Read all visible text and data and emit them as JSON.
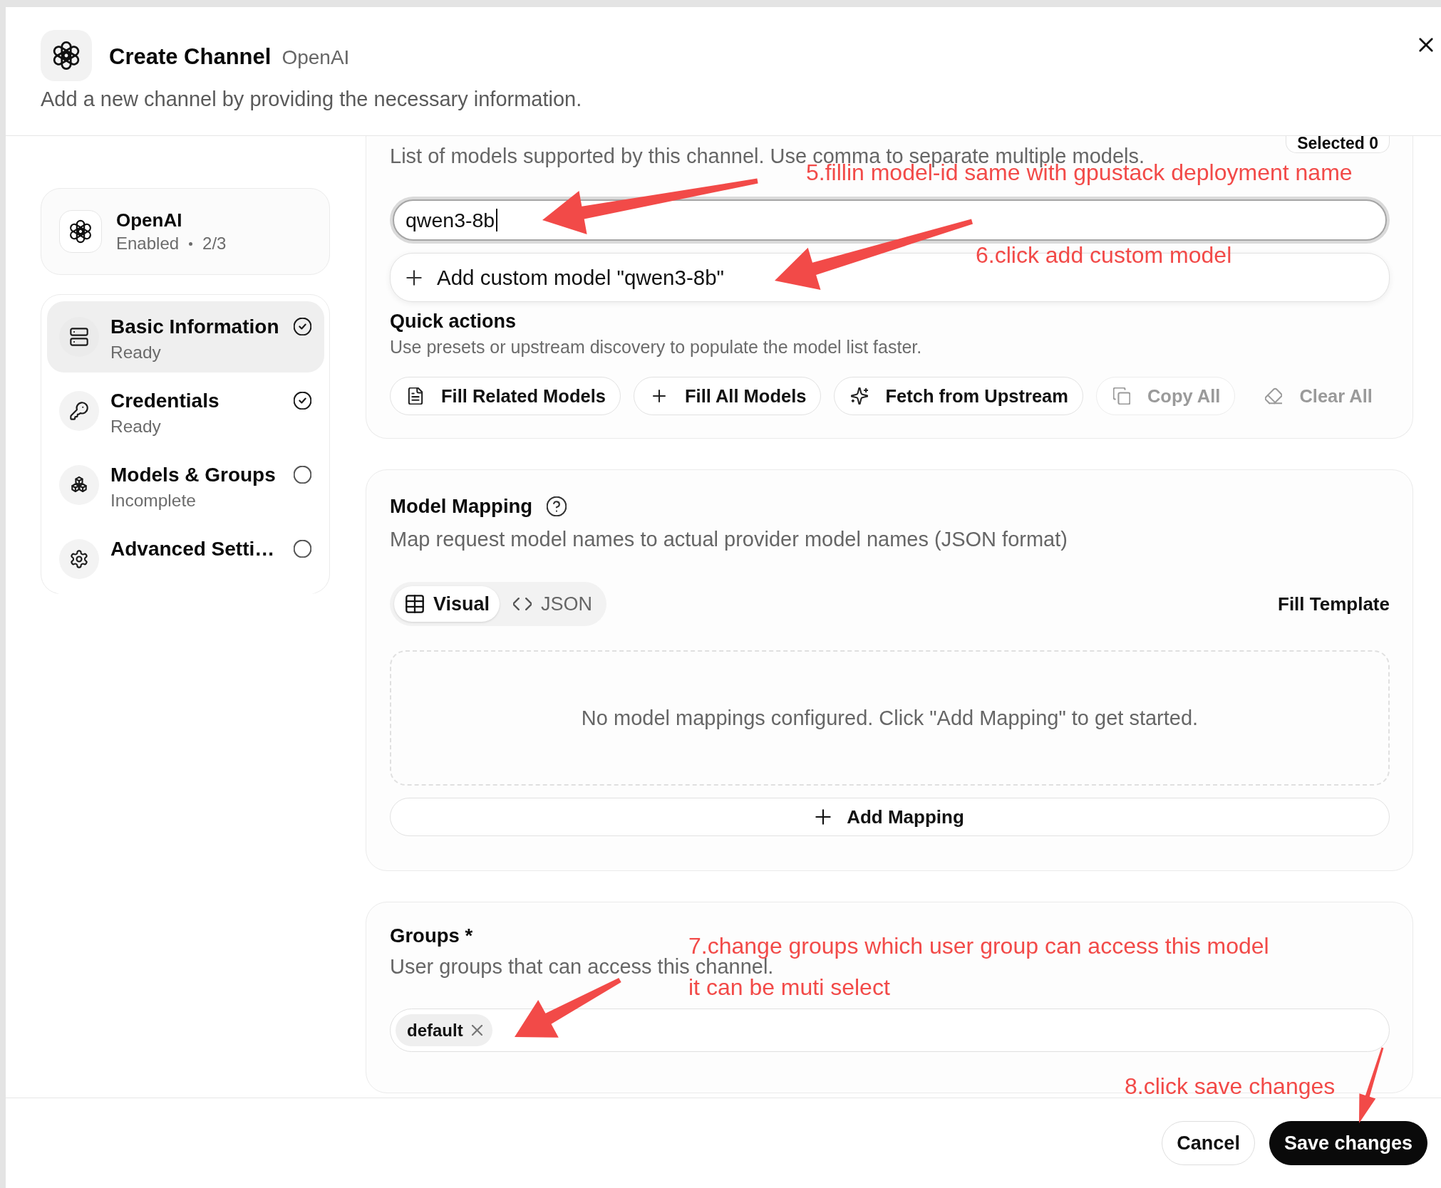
{
  "dialog": {
    "title": "Create Channel",
    "provider": "OpenAI",
    "description": "Add a new channel by providing the necessary information."
  },
  "sidebar": {
    "provider_card": {
      "name": "OpenAI",
      "status": "Enabled",
      "steps_done": "2/3"
    },
    "steps": [
      {
        "title": "Basic Information",
        "status": "Ready",
        "selected": true,
        "complete": true
      },
      {
        "title": "Credentials",
        "status": "Ready",
        "selected": false,
        "complete": true
      },
      {
        "title": "Models & Groups",
        "status": "Incomplete",
        "selected": false,
        "complete": false
      },
      {
        "title": "Advanced Setti…",
        "selected": false,
        "complete": false
      }
    ]
  },
  "models": {
    "hint": "List of models supported by this channel. Use comma to separate multiple models.",
    "selected_badge": "Selected 0",
    "input": {
      "value": "qwen3-8b",
      "focused": true
    },
    "suggestion": "Add custom model \"qwen3-8b\"",
    "quick_actions": {
      "title": "Quick actions",
      "description": "Use presets or upstream discovery to populate the model list faster.",
      "buttons": [
        {
          "label": "Fill Related Models",
          "kind": "outline",
          "disabled": false
        },
        {
          "label": "Fill All Models",
          "kind": "outline",
          "disabled": false
        },
        {
          "label": "Fetch from Upstream",
          "kind": "outline",
          "disabled": false
        },
        {
          "label": "Copy All",
          "kind": "outline",
          "disabled": true
        },
        {
          "label": "Clear All",
          "kind": "ghost",
          "disabled": true
        }
      ]
    }
  },
  "model_mapping": {
    "title": "Model Mapping",
    "description": "Map request model names to actual provider model names (JSON format)",
    "tabs": [
      {
        "label": "Visual",
        "selected": true
      },
      {
        "label": "JSON",
        "selected": false
      }
    ],
    "fill_template": "Fill Template",
    "empty_message": "No model mappings configured. Click \"Add Mapping\" to get started.",
    "add_button": "Add Mapping"
  },
  "groups": {
    "title": "Groups *",
    "description": "User groups that can access this channel.",
    "chips": [
      {
        "label": "default"
      }
    ]
  },
  "footer": {
    "buttons": [
      {
        "label": "Cancel",
        "kind": "secondary"
      },
      {
        "label": "Save changes",
        "kind": "primary"
      }
    ]
  },
  "annotations": [
    {
      "lines": [
        "5.fillin model-id same with gpustack deployment name"
      ]
    },
    {
      "lines": [
        "6.click add custom model"
      ]
    },
    {
      "lines": [
        "7.change groups which user group can access this model",
        "it can be muti select"
      ]
    },
    {
      "lines": [
        "8.click save changes"
      ]
    }
  ]
}
